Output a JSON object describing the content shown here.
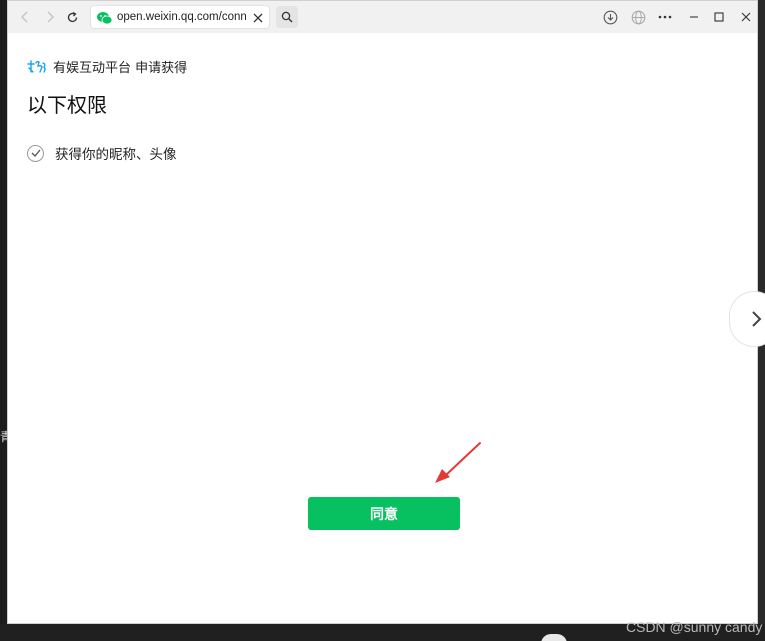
{
  "browser": {
    "url": "open.weixin.qq.com/conne",
    "icons": [
      "back-icon",
      "forward-icon",
      "reload-icon",
      "wechat-favicon",
      "close-icon",
      "search-icon",
      "download-icon",
      "globe-icon",
      "more-icon",
      "minimize-icon",
      "maximize-icon",
      "window-close-icon"
    ]
  },
  "page": {
    "app_line": "有娱互动平台 申请获得",
    "title": "以下权限",
    "permission": "获得你的昵称、头像",
    "agree_button": "同意"
  },
  "watermark": "CSDN @sunny candy",
  "left_edge_char": "青",
  "colors": {
    "accent_green": "#07c160",
    "annotation_red": "#e53935",
    "logo_blue": "#1aa3e8"
  }
}
